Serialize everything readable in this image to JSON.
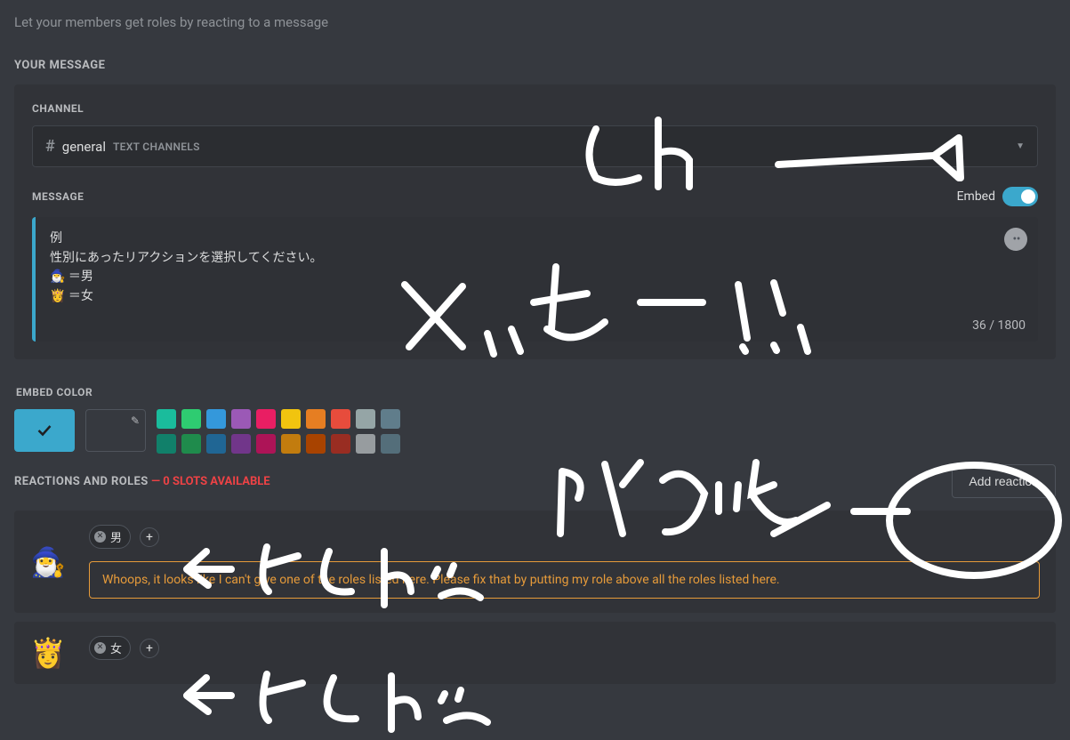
{
  "subtitle": "Let your members get roles by reacting to a message",
  "sections": {
    "your_message_heading": "YOUR MESSAGE"
  },
  "channel": {
    "label": "CHANNEL",
    "name": "general",
    "type": "TEXT CHANNELS"
  },
  "message": {
    "label": "MESSAGE",
    "embed_toggle_label": "Embed",
    "embed_toggle_on": true,
    "lines": {
      "l1": "例",
      "l2": "性別にあったリアクションを選択してください。",
      "l3": "🧙‍♂️ ＝男",
      "l4": "👸 ＝女"
    },
    "char_count": "36 / 1800"
  },
  "embed_color": {
    "label": "EMBED COLOR",
    "selected": "#3ba8cc",
    "palette": [
      "#1abc9c",
      "#2ecc71",
      "#3498db",
      "#9b59b6",
      "#e91e63",
      "#f1c40f",
      "#e67e22",
      "#e74c3c",
      "#95a5a6",
      "#607d8b",
      "#11806a",
      "#1f8b4c",
      "#206694",
      "#71368a",
      "#ad1457",
      "#c27c0e",
      "#a84300",
      "#992d22",
      "#979c9f",
      "#546e7a"
    ]
  },
  "reactions": {
    "heading": "REACTIONS AND ROLES",
    "slots": "— 0 SLOTS AVAILABLE",
    "add_button": "Add reaction",
    "items": [
      {
        "emoji": "🧙‍♂️",
        "role": "男",
        "warning": "Whoops, it looks like I can't give one of the roles listed here. Please fix that by putting my role above all the roles listed here."
      },
      {
        "emoji": "👸",
        "role": "女",
        "warning": null
      }
    ]
  },
  "annotations": {
    "ch": "Ch",
    "message": "メッセージ",
    "reaction": "リアクション",
    "role1": "← やくしょく",
    "role2": "← やくしょく"
  }
}
